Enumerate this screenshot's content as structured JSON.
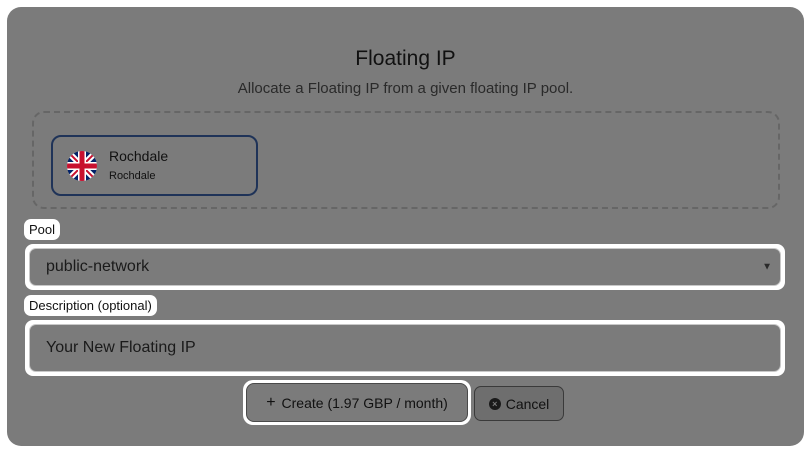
{
  "modal": {
    "title": "Floating IP",
    "subtitle": "Allocate a Floating IP from a given floating IP pool."
  },
  "region": {
    "name": "Rochdale",
    "subname": "Rochdale",
    "flag_icon": "uk-flag-icon"
  },
  "pool": {
    "label": "Pool",
    "value": "public-network"
  },
  "description": {
    "label": "Description (optional)",
    "value": "Your New Floating IP"
  },
  "actions": {
    "create_label": "Create (1.97 GBP / month)",
    "cancel_label": "Cancel"
  },
  "colors": {
    "overlay": "#7b7b7b",
    "card_border": "#1f3358"
  }
}
